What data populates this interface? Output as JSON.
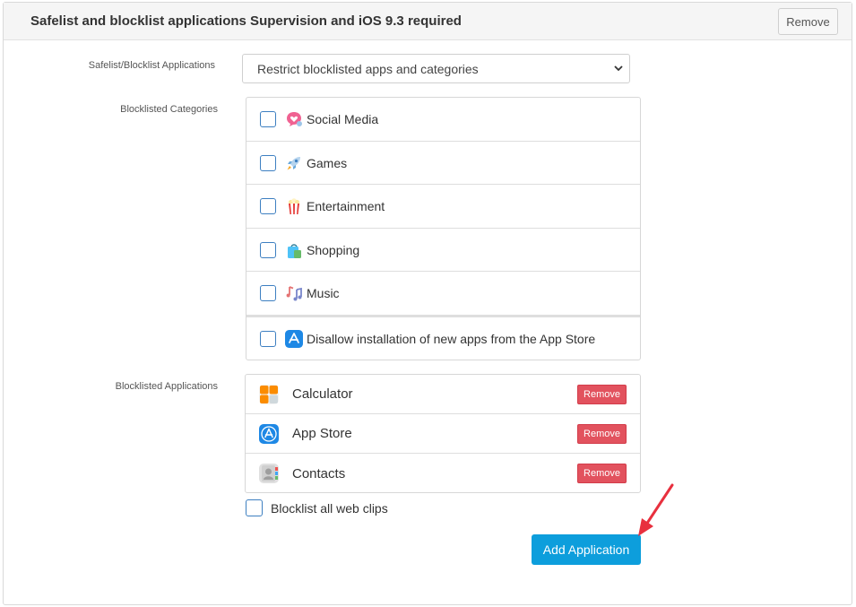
{
  "header": {
    "title": "Safelist and blocklist applications Supervision and iOS 9.3 required",
    "remove_label": "Remove"
  },
  "mode": {
    "label": "Safelist/Blocklist Applications",
    "selected": "Restrict blocklisted apps and categories"
  },
  "categories": {
    "label": "Blocklisted Categories",
    "items": [
      {
        "label": "Social Media",
        "icon": "social-media-icon",
        "checked": false
      },
      {
        "label": "Games",
        "icon": "rocket-icon",
        "checked": false
      },
      {
        "label": "Entertainment",
        "icon": "popcorn-icon",
        "checked": false
      },
      {
        "label": "Shopping",
        "icon": "shopping-bag-icon",
        "checked": false
      },
      {
        "label": "Music",
        "icon": "music-notes-icon",
        "checked": false
      }
    ],
    "app_store_option": {
      "label": "Disallow installation of new apps from the App Store",
      "icon": "app-store-icon",
      "checked": false
    }
  },
  "applications": {
    "label": "Blocklisted Applications",
    "items": [
      {
        "name": "Calculator",
        "icon": "calculator-icon",
        "remove_label": "Remove"
      },
      {
        "name": "App Store",
        "icon": "app-store-icon",
        "remove_label": "Remove"
      },
      {
        "name": "Contacts",
        "icon": "contacts-icon",
        "remove_label": "Remove"
      }
    ]
  },
  "web_clips": {
    "label": "Blocklist all web clips",
    "checked": false
  },
  "add_button": {
    "label": "Add Application"
  },
  "colors": {
    "accent": "#0d9edc",
    "danger": "#e2525e",
    "checkbox_border": "#3d7fc1",
    "annotation_arrow": "#e8303e"
  }
}
